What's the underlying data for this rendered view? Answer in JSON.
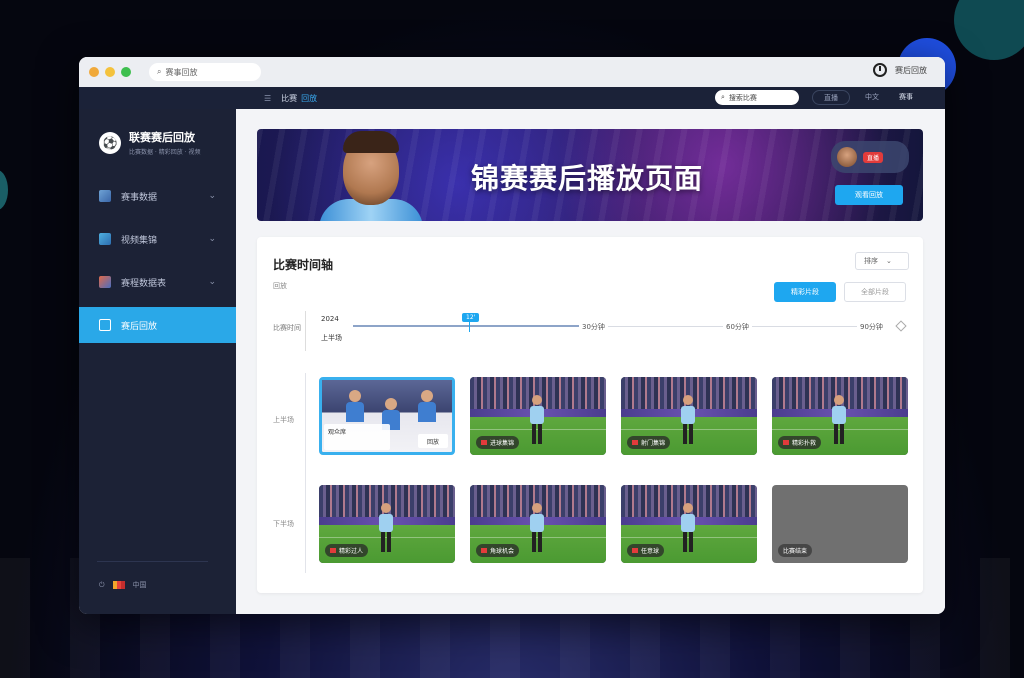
{
  "browser": {
    "url_text": "赛事回放"
  },
  "chrome_right": {
    "user_label": "赛后回放"
  },
  "topbar": {
    "menu_icon": "hamburger-icon",
    "crumb_1": "比赛",
    "crumb_2": "回放",
    "search_placeholder": "搜索比赛",
    "button_label": "直播",
    "lang_label": "中文",
    "user_label": "赛事"
  },
  "sidebar": {
    "brand_title": "联赛赛后回放",
    "brand_sub": "比赛数据 · 精彩回放 · 视频",
    "items": [
      {
        "label": "赛事数据",
        "icon": "soccer-ball-icon",
        "active": false
      },
      {
        "label": "视频集锦",
        "icon": "video-icon",
        "active": false
      },
      {
        "label": "赛程数据表",
        "icon": "chart-icon",
        "active": false
      },
      {
        "label": "赛后回放",
        "icon": "playback-icon",
        "active": true
      }
    ],
    "footer_text": "中国"
  },
  "banner": {
    "title": "锦赛赛后播放页面",
    "live_label": "直播",
    "button_label": "观看回放"
  },
  "panel": {
    "title": "比赛时间轴",
    "subtitle": "回放",
    "sort_label": "排序",
    "primary_button": "精彩片段",
    "ghost_button": "全部片段",
    "timeline_label": "比赛时间",
    "date": "2024",
    "time": "上半场",
    "marker": "12'",
    "ticks": [
      "30分钟",
      "60分钟",
      "90分钟"
    ],
    "row1_label": "上半场",
    "row2_label": "下半场",
    "clips_row1": [
      {
        "tag": "观众席",
        "selected": true,
        "corner": "回放"
      },
      {
        "tag": "进球集锦"
      },
      {
        "tag": "射门集锦"
      },
      {
        "tag": "精彩扑救"
      }
    ],
    "clips_row2": [
      {
        "tag": "精彩过人"
      },
      {
        "tag": "角球机会"
      },
      {
        "tag": "任意球"
      },
      {
        "tag": "比赛结束",
        "empty": true
      }
    ]
  },
  "colors": {
    "accent": "#1ea7f0",
    "sidebar_bg": "#1c2236",
    "live_red": "#e23b3b"
  }
}
